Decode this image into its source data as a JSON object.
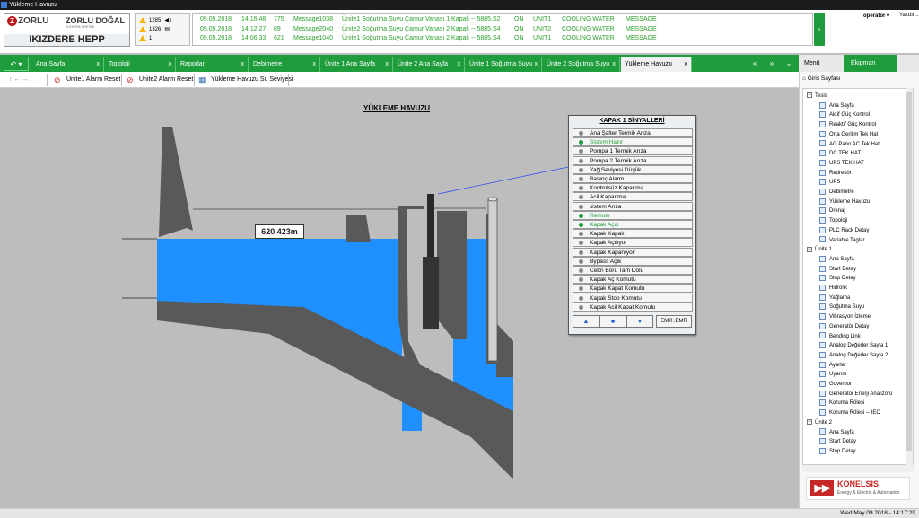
{
  "window": {
    "title": "Yükleme Havuzu"
  },
  "logo": {
    "brand1": "ZORLU",
    "brand2": "ZORLU DOĞAL",
    "sub": "ELEKTRİK ÜRETİMİ",
    "plant": "IKIZDERE HEPP"
  },
  "alarm_summary": {
    "row1": "1285",
    "row2": "1326",
    "row3": "1"
  },
  "messages": [
    {
      "date": "09.05.2018",
      "time": "14:16:48",
      "code": "775",
      "msg_id": "Message1038",
      "text": "Ünite1 Soğutma Suyu Çamur Vanası 1 Kapalı -- 5885.S2",
      "state": "ON",
      "unit": "UNIT1",
      "system": "COOLING WATER",
      "type": "MESSAGE"
    },
    {
      "date": "09.05.2018",
      "time": "14:12:27",
      "code": "89",
      "msg_id": "Message2040",
      "text": "Ünite2 Soğutma Suyu Çamur Vanası 2 Kapalı -- 5885.S4",
      "state": "ON",
      "unit": "UNIT2",
      "system": "COOLING WATER",
      "type": "MESSAGE"
    },
    {
      "date": "09.05.2018",
      "time": "14:06:33",
      "code": "621",
      "msg_id": "Message1040",
      "text": "Ünite1 Soğutma Suyu Çamur Vanası 2 Kapalı -- 5885.S4",
      "state": "ON",
      "unit": "UNIT1",
      "system": "COOLING WATER",
      "type": "MESSAGE"
    }
  ],
  "user": {
    "name": "operator",
    "print": "Yazdır..."
  },
  "tabs": [
    "Ana Sayfa",
    "Topoloji",
    "Raporlar",
    "Debimetre",
    "Ünite 1 Ana Sayfa",
    "Ünite 2 Ana Sayfa",
    "Ünite 1 Soğutma Suyu",
    "Ünite 2 Soğutma Suyu",
    "Yükleme Havuzu"
  ],
  "tab_close": "x",
  "nav": {
    "back": "«",
    "fwd": "»",
    "menu": "⌄"
  },
  "right_tabs": {
    "menu": "Menü",
    "equipment": "Ekipman"
  },
  "toolbar": {
    "reset1": "Ünite1 Alarm Reset",
    "reset2": "Ünite2 Alarm Reset",
    "level": "Yükleme Havuzu Su Seviyesi"
  },
  "page": {
    "title": "YÜKLEME HAVUZU",
    "level_value": "620.423m"
  },
  "signals": {
    "title": "KAPAK 1 SİNYALLERİ",
    "items": [
      {
        "label": "Ana Şalter Termik Arıza",
        "on": false
      },
      {
        "label": "Sistem Hazır",
        "on": true
      },
      {
        "label": "Pompa 1 Termik Arıza",
        "on": false
      },
      {
        "label": "Pompa 2 Termik Arıza",
        "on": false
      },
      {
        "label": "Yağ Seviyesi Düşük",
        "on": false
      },
      {
        "label": "Basınç Alarm",
        "on": false
      },
      {
        "label": "Kontrolsüz Kapanma",
        "on": false
      },
      {
        "label": "Acil Kapanma",
        "on": false
      },
      {
        "label": "sistem Arıza",
        "on": false
      },
      {
        "label": "Remote",
        "on": true
      },
      {
        "label": "Kapak Açık",
        "on": true
      },
      {
        "label": "Kapak Kapalı",
        "on": false
      },
      {
        "label": "Kapak Açılıyor",
        "on": false
      },
      {
        "label": "Kapak Kapanıyor",
        "on": false
      },
      {
        "label": "Bypass Açık",
        "on": false
      },
      {
        "label": "Cebri Boru Tam Dolu",
        "on": false
      },
      {
        "label": "Kapak Aç Komutu",
        "on": false
      },
      {
        "label": "Kapak Kapat Komutu",
        "on": false
      },
      {
        "label": "Kapak Stop Komutu",
        "on": false
      },
      {
        "label": "Kapak Acil Kapat Komutu",
        "on": false
      }
    ],
    "buttons": {
      "emr": "EMR",
      "emr2": "EMR"
    }
  },
  "tree": {
    "home": "Giriş Sayfası",
    "nodes": [
      {
        "label": "Tesis",
        "group": true
      },
      {
        "label": "Ana Sayfa"
      },
      {
        "label": "Aktif Güç Kontrol"
      },
      {
        "label": "Reaktif Güç Kontrol"
      },
      {
        "label": "Orta Gerilim Tek Hat"
      },
      {
        "label": "AG Pano AC Tek Hat"
      },
      {
        "label": "DC TEK HAT"
      },
      {
        "label": "UPS TEK HAT"
      },
      {
        "label": "Redresör"
      },
      {
        "label": "UPS"
      },
      {
        "label": "Debimetre"
      },
      {
        "label": "Yükleme Havuzu"
      },
      {
        "label": "Drenaj"
      },
      {
        "label": "Topoloji"
      },
      {
        "label": "PLC Rack Detay"
      },
      {
        "label": "Variable Taglar"
      },
      {
        "label": "Ünite 1",
        "group": true
      },
      {
        "label": "Ana Sayfa"
      },
      {
        "label": "Start Detay"
      },
      {
        "label": "Stop Detay"
      },
      {
        "label": "Hidrolik"
      },
      {
        "label": "Yağlama"
      },
      {
        "label": "Soğutma Suyu"
      },
      {
        "label": "Vibrasyon İzleme"
      },
      {
        "label": "Generatör Detay"
      },
      {
        "label": "Bending Link"
      },
      {
        "label": "Analog Değerler Sayfa 1"
      },
      {
        "label": "Analog Değerler Sayfa 2"
      },
      {
        "label": "Ayarlar"
      },
      {
        "label": "Uyarım"
      },
      {
        "label": "Governor"
      },
      {
        "label": "Generatör Enerji Analizörü"
      },
      {
        "label": "Koruma Rölesi"
      },
      {
        "label": "Koruma Rölesi -- IEC"
      },
      {
        "label": "Ünite 2",
        "group": true
      },
      {
        "label": "Ana Sayfa"
      },
      {
        "label": "Start Detay"
      },
      {
        "label": "Stop Detay"
      }
    ]
  },
  "vendor": {
    "name": "KONELSIS",
    "tagline": "Energy & Electric & Automation"
  },
  "status": {
    "clock": "Wed May 09 2018 - 14:17:29"
  },
  "colors": {
    "accent": "#1f9d3c",
    "water": "#1e90ff",
    "concrete": "#595959",
    "signal_on": "#1e9d3a",
    "message": "#2ea02e"
  }
}
